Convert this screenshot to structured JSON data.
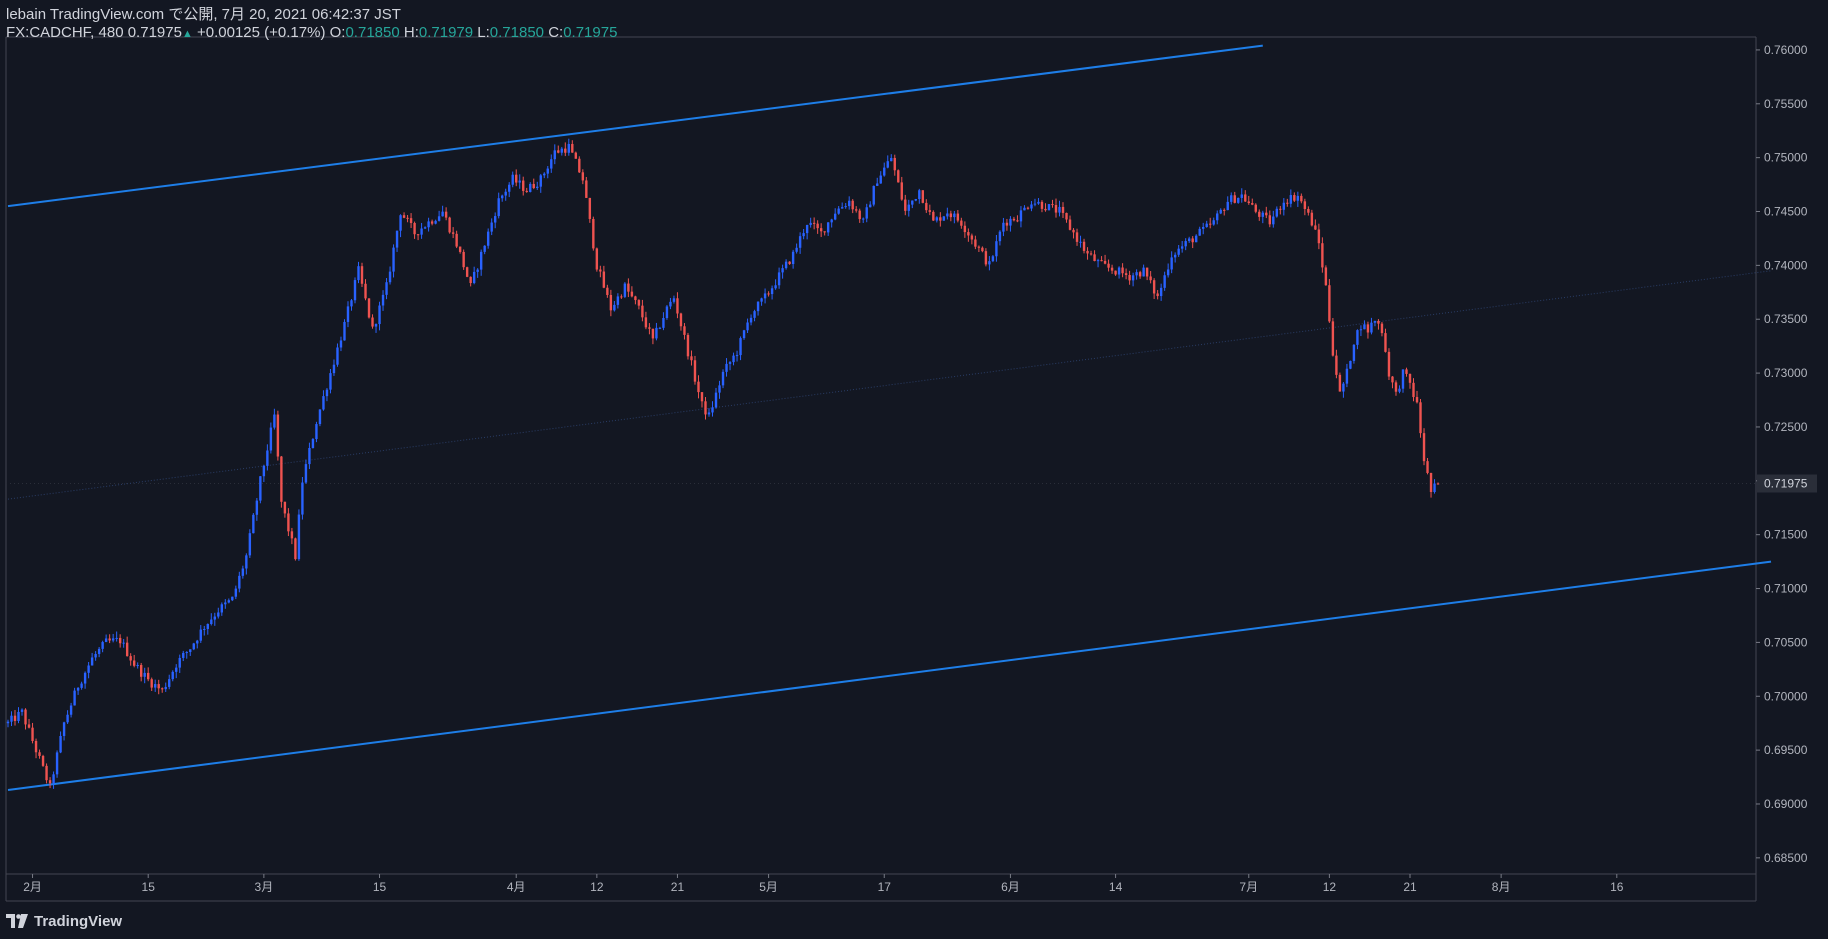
{
  "header": {
    "line1": "lebain TradingView.com で公開, 7月 20, 2021 06:42:37 JST",
    "symbol": "FX:CADCHF, 480",
    "last": "0.71975",
    "change": "+0.00125 (+0.17%)",
    "o_label": "O:",
    "o_value": "0.71850",
    "h_label": "H:",
    "h_value": "0.71979",
    "l_label": "L:",
    "l_value": "0.71850",
    "c_label": "C:",
    "c_value": "0.71975"
  },
  "footer": {
    "brand": "TradingView"
  },
  "colors": {
    "background": "#131722",
    "up": "#2962ff",
    "down": "#ef5350",
    "trendline": "#1e7ee8",
    "text": "#d1d4dc",
    "green": "#26a69a"
  },
  "chart_data": {
    "type": "candlestick",
    "symbol": "FX:CADCHF",
    "interval": "480",
    "ylim": [
      0.6835,
      0.7612
    ],
    "yticks": [
      "0.76000",
      "0.75500",
      "0.75000",
      "0.74500",
      "0.74000",
      "0.73500",
      "0.73000",
      "0.72500",
      "0.72000",
      "0.71500",
      "0.71000",
      "0.70500",
      "0.70000",
      "0.69500",
      "0.69000",
      "0.68500"
    ],
    "current_price_label": "0.71975",
    "current_price": 0.71975,
    "xticks": [
      {
        "label": "2月",
        "date": "2021-02-01",
        "bar": 7
      },
      {
        "label": "15",
        "date": "2021-02-15",
        "bar": 40
      },
      {
        "label": "3月",
        "date": "2021-03-01",
        "bar": 73
      },
      {
        "label": "15",
        "date": "2021-03-15",
        "bar": 106
      },
      {
        "label": "4月",
        "date": "2021-04-01",
        "bar": 145
      },
      {
        "label": "12",
        "date": "2021-04-12",
        "bar": 168
      },
      {
        "label": "21",
        "date": "2021-04-21",
        "bar": 191
      },
      {
        "label": "5月",
        "date": "2021-05-05",
        "bar": 217
      },
      {
        "label": "17",
        "date": "2021-05-17",
        "bar": 250
      },
      {
        "label": "6月",
        "date": "2021-06-01",
        "bar": 286
      },
      {
        "label": "14",
        "date": "2021-06-14",
        "bar": 316
      },
      {
        "label": "7月",
        "date": "2021-07-01",
        "bar": 354
      },
      {
        "label": "12",
        "date": "2021-07-12",
        "bar": 377
      },
      {
        "label": "21",
        "date": "2021-07-21",
        "bar": 400
      },
      {
        "label": "8月",
        "date": "2021-08-02",
        "bar": 426
      },
      {
        "label": "16",
        "date": "2021-08-16",
        "bar": 459
      }
    ],
    "last_bar": 394,
    "trendlines": [
      {
        "name": "upper-channel",
        "x1": 0,
        "y1": 0.7455,
        "x2": 358,
        "y2": 0.7604,
        "style": "solid"
      },
      {
        "name": "lower-channel",
        "x1": 0,
        "y1": 0.6913,
        "x2": 503,
        "y2": 0.7125,
        "style": "solid"
      },
      {
        "name": "mid-channel",
        "x1": 0,
        "y1": 0.7183,
        "x2": 503,
        "y2": 0.7395,
        "style": "dotted"
      }
    ],
    "path_points": [
      [
        0,
        0.6975
      ],
      [
        4,
        0.6985
      ],
      [
        8,
        0.695
      ],
      [
        12,
        0.6915
      ],
      [
        16,
        0.6975
      ],
      [
        20,
        0.701
      ],
      [
        24,
        0.7035
      ],
      [
        28,
        0.705
      ],
      [
        32,
        0.7052
      ],
      [
        36,
        0.703
      ],
      [
        40,
        0.7015
      ],
      [
        44,
        0.7005
      ],
      [
        48,
        0.703
      ],
      [
        52,
        0.7045
      ],
      [
        56,
        0.7065
      ],
      [
        60,
        0.708
      ],
      [
        64,
        0.709
      ],
      [
        68,
        0.713
      ],
      [
        72,
        0.72
      ],
      [
        76,
        0.726
      ],
      [
        78,
        0.718
      ],
      [
        82,
        0.713
      ],
      [
        84,
        0.72
      ],
      [
        88,
        0.7255
      ],
      [
        92,
        0.73
      ],
      [
        96,
        0.7345
      ],
      [
        100,
        0.7395
      ],
      [
        104,
        0.734
      ],
      [
        108,
        0.738
      ],
      [
        112,
        0.745
      ],
      [
        116,
        0.743
      ],
      [
        120,
        0.744
      ],
      [
        124,
        0.745
      ],
      [
        128,
        0.742
      ],
      [
        132,
        0.738
      ],
      [
        136,
        0.742
      ],
      [
        140,
        0.746
      ],
      [
        144,
        0.748
      ],
      [
        148,
        0.747
      ],
      [
        152,
        0.748
      ],
      [
        156,
        0.7505
      ],
      [
        160,
        0.751
      ],
      [
        164,
        0.748
      ],
      [
        166,
        0.744
      ],
      [
        168,
        0.74
      ],
      [
        172,
        0.736
      ],
      [
        176,
        0.738
      ],
      [
        180,
        0.736
      ],
      [
        184,
        0.733
      ],
      [
        188,
        0.736
      ],
      [
        190,
        0.737
      ],
      [
        194,
        0.732
      ],
      [
        198,
        0.727
      ],
      [
        200,
        0.726
      ],
      [
        204,
        0.73
      ],
      [
        208,
        0.732
      ],
      [
        212,
        0.7355
      ],
      [
        216,
        0.737
      ],
      [
        220,
        0.739
      ],
      [
        224,
        0.741
      ],
      [
        228,
        0.744
      ],
      [
        232,
        0.743
      ],
      [
        236,
        0.745
      ],
      [
        240,
        0.746
      ],
      [
        244,
        0.744
      ],
      [
        248,
        0.748
      ],
      [
        252,
        0.75
      ],
      [
        256,
        0.745
      ],
      [
        260,
        0.747
      ],
      [
        264,
        0.744
      ],
      [
        268,
        0.745
      ],
      [
        272,
        0.744
      ],
      [
        276,
        0.742
      ],
      [
        280,
        0.74
      ],
      [
        284,
        0.744
      ],
      [
        288,
        0.7445
      ],
      [
        292,
        0.746
      ],
      [
        296,
        0.7455
      ],
      [
        300,
        0.745
      ],
      [
        304,
        0.743
      ],
      [
        308,
        0.741
      ],
      [
        312,
        0.74
      ],
      [
        316,
        0.7395
      ],
      [
        320,
        0.739
      ],
      [
        324,
        0.7395
      ],
      [
        328,
        0.737
      ],
      [
        332,
        0.741
      ],
      [
        336,
        0.742
      ],
      [
        340,
        0.743
      ],
      [
        344,
        0.744
      ],
      [
        348,
        0.746
      ],
      [
        352,
        0.7465
      ],
      [
        356,
        0.745
      ],
      [
        360,
        0.744
      ],
      [
        364,
        0.746
      ],
      [
        368,
        0.7465
      ],
      [
        372,
        0.744
      ],
      [
        374,
        0.742
      ],
      [
        376,
        0.738
      ],
      [
        378,
        0.732
      ],
      [
        380,
        0.728
      ],
      [
        382,
        0.73
      ],
      [
        384,
        0.733
      ],
      [
        386,
        0.7345
      ],
      [
        388,
        0.734
      ],
      [
        390,
        0.735
      ],
      [
        392,
        0.734
      ],
      [
        394,
        0.73
      ],
      [
        396,
        0.728
      ],
      [
        398,
        0.73
      ],
      [
        400,
        0.729
      ],
      [
        402,
        0.727
      ],
      [
        404,
        0.722
      ],
      [
        406,
        0.719
      ],
      [
        408,
        0.71975
      ]
    ]
  }
}
